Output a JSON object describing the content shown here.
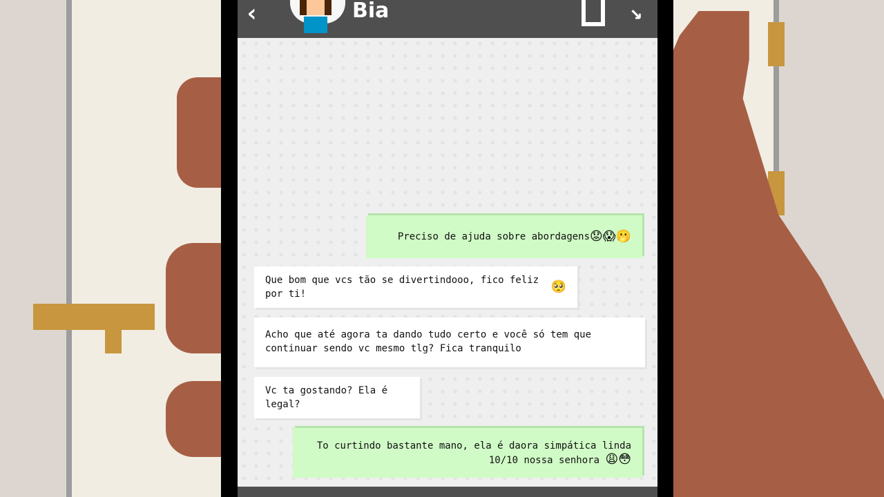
{
  "chat": {
    "contact_name": "Bia",
    "messages": [
      {
        "side": "sent",
        "text": "Preciso de ajuda sobre abordagens",
        "emoji": "😟😱🫢"
      },
      {
        "side": "received",
        "text": "Que bom que vcs tão se divertindooo, fico feliz por ti!",
        "emoji": "🥺"
      },
      {
        "side": "received",
        "text": "Acho que até agora ta dando tudo certo e você só tem que continuar sendo vc mesmo tlg? Fica tranquilo",
        "emoji": ""
      },
      {
        "side": "received",
        "text": "Vc ta gostando? Ela é legal?",
        "emoji": ""
      },
      {
        "side": "sent",
        "text": "To curtindo bastante mano, ela é daora simpática linda 10/10 nossa senhora",
        "emoji": "😩😳"
      }
    ]
  },
  "icons": {
    "back": "chevron-left-icon",
    "video": "video-call-icon",
    "phone": "phone-icon"
  },
  "colors": {
    "header": "#4f4f4f",
    "sent_bubble": "#d0fbc6",
    "received_bubble": "#ffffff",
    "hand": "#a65f45"
  }
}
